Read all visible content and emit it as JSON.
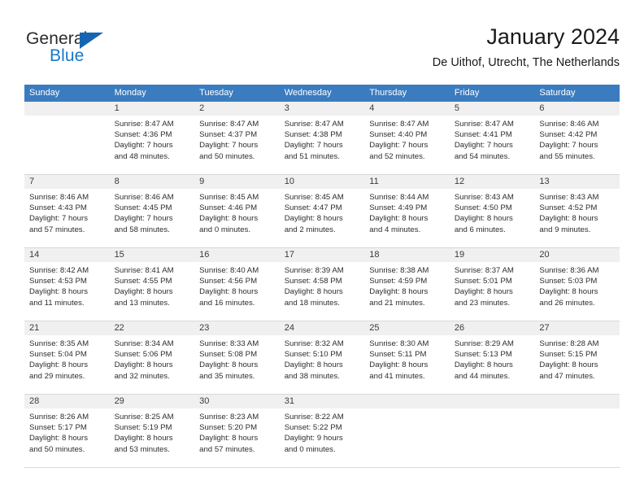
{
  "brand": {
    "name_top": "General",
    "name_bottom": "Blue",
    "accent_color": "#1878c8",
    "triangle_color": "#1565b0"
  },
  "header": {
    "title": "January 2024",
    "subtitle": "De Uithof, Utrecht, The Netherlands"
  },
  "calendar": {
    "header_bg": "#3b7cc0",
    "daynum_bg": "#f0f0f0",
    "weekdays": [
      "Sunday",
      "Monday",
      "Tuesday",
      "Wednesday",
      "Thursday",
      "Friday",
      "Saturday"
    ],
    "weeks": [
      [
        {
          "day": "",
          "sunrise": "",
          "sunset": "",
          "daylight1": "",
          "daylight2": "",
          "empty": true
        },
        {
          "day": "1",
          "sunrise": "Sunrise: 8:47 AM",
          "sunset": "Sunset: 4:36 PM",
          "daylight1": "Daylight: 7 hours",
          "daylight2": "and 48 minutes."
        },
        {
          "day": "2",
          "sunrise": "Sunrise: 8:47 AM",
          "sunset": "Sunset: 4:37 PM",
          "daylight1": "Daylight: 7 hours",
          "daylight2": "and 50 minutes."
        },
        {
          "day": "3",
          "sunrise": "Sunrise: 8:47 AM",
          "sunset": "Sunset: 4:38 PM",
          "daylight1": "Daylight: 7 hours",
          "daylight2": "and 51 minutes."
        },
        {
          "day": "4",
          "sunrise": "Sunrise: 8:47 AM",
          "sunset": "Sunset: 4:40 PM",
          "daylight1": "Daylight: 7 hours",
          "daylight2": "and 52 minutes."
        },
        {
          "day": "5",
          "sunrise": "Sunrise: 8:47 AM",
          "sunset": "Sunset: 4:41 PM",
          "daylight1": "Daylight: 7 hours",
          "daylight2": "and 54 minutes."
        },
        {
          "day": "6",
          "sunrise": "Sunrise: 8:46 AM",
          "sunset": "Sunset: 4:42 PM",
          "daylight1": "Daylight: 7 hours",
          "daylight2": "and 55 minutes."
        }
      ],
      [
        {
          "day": "7",
          "sunrise": "Sunrise: 8:46 AM",
          "sunset": "Sunset: 4:43 PM",
          "daylight1": "Daylight: 7 hours",
          "daylight2": "and 57 minutes."
        },
        {
          "day": "8",
          "sunrise": "Sunrise: 8:46 AM",
          "sunset": "Sunset: 4:45 PM",
          "daylight1": "Daylight: 7 hours",
          "daylight2": "and 58 minutes."
        },
        {
          "day": "9",
          "sunrise": "Sunrise: 8:45 AM",
          "sunset": "Sunset: 4:46 PM",
          "daylight1": "Daylight: 8 hours",
          "daylight2": "and 0 minutes."
        },
        {
          "day": "10",
          "sunrise": "Sunrise: 8:45 AM",
          "sunset": "Sunset: 4:47 PM",
          "daylight1": "Daylight: 8 hours",
          "daylight2": "and 2 minutes."
        },
        {
          "day": "11",
          "sunrise": "Sunrise: 8:44 AM",
          "sunset": "Sunset: 4:49 PM",
          "daylight1": "Daylight: 8 hours",
          "daylight2": "and 4 minutes."
        },
        {
          "day": "12",
          "sunrise": "Sunrise: 8:43 AM",
          "sunset": "Sunset: 4:50 PM",
          "daylight1": "Daylight: 8 hours",
          "daylight2": "and 6 minutes."
        },
        {
          "day": "13",
          "sunrise": "Sunrise: 8:43 AM",
          "sunset": "Sunset: 4:52 PM",
          "daylight1": "Daylight: 8 hours",
          "daylight2": "and 9 minutes."
        }
      ],
      [
        {
          "day": "14",
          "sunrise": "Sunrise: 8:42 AM",
          "sunset": "Sunset: 4:53 PM",
          "daylight1": "Daylight: 8 hours",
          "daylight2": "and 11 minutes."
        },
        {
          "day": "15",
          "sunrise": "Sunrise: 8:41 AM",
          "sunset": "Sunset: 4:55 PM",
          "daylight1": "Daylight: 8 hours",
          "daylight2": "and 13 minutes."
        },
        {
          "day": "16",
          "sunrise": "Sunrise: 8:40 AM",
          "sunset": "Sunset: 4:56 PM",
          "daylight1": "Daylight: 8 hours",
          "daylight2": "and 16 minutes."
        },
        {
          "day": "17",
          "sunrise": "Sunrise: 8:39 AM",
          "sunset": "Sunset: 4:58 PM",
          "daylight1": "Daylight: 8 hours",
          "daylight2": "and 18 minutes."
        },
        {
          "day": "18",
          "sunrise": "Sunrise: 8:38 AM",
          "sunset": "Sunset: 4:59 PM",
          "daylight1": "Daylight: 8 hours",
          "daylight2": "and 21 minutes."
        },
        {
          "day": "19",
          "sunrise": "Sunrise: 8:37 AM",
          "sunset": "Sunset: 5:01 PM",
          "daylight1": "Daylight: 8 hours",
          "daylight2": "and 23 minutes."
        },
        {
          "day": "20",
          "sunrise": "Sunrise: 8:36 AM",
          "sunset": "Sunset: 5:03 PM",
          "daylight1": "Daylight: 8 hours",
          "daylight2": "and 26 minutes."
        }
      ],
      [
        {
          "day": "21",
          "sunrise": "Sunrise: 8:35 AM",
          "sunset": "Sunset: 5:04 PM",
          "daylight1": "Daylight: 8 hours",
          "daylight2": "and 29 minutes."
        },
        {
          "day": "22",
          "sunrise": "Sunrise: 8:34 AM",
          "sunset": "Sunset: 5:06 PM",
          "daylight1": "Daylight: 8 hours",
          "daylight2": "and 32 minutes."
        },
        {
          "day": "23",
          "sunrise": "Sunrise: 8:33 AM",
          "sunset": "Sunset: 5:08 PM",
          "daylight1": "Daylight: 8 hours",
          "daylight2": "and 35 minutes."
        },
        {
          "day": "24",
          "sunrise": "Sunrise: 8:32 AM",
          "sunset": "Sunset: 5:10 PM",
          "daylight1": "Daylight: 8 hours",
          "daylight2": "and 38 minutes."
        },
        {
          "day": "25",
          "sunrise": "Sunrise: 8:30 AM",
          "sunset": "Sunset: 5:11 PM",
          "daylight1": "Daylight: 8 hours",
          "daylight2": "and 41 minutes."
        },
        {
          "day": "26",
          "sunrise": "Sunrise: 8:29 AM",
          "sunset": "Sunset: 5:13 PM",
          "daylight1": "Daylight: 8 hours",
          "daylight2": "and 44 minutes."
        },
        {
          "day": "27",
          "sunrise": "Sunrise: 8:28 AM",
          "sunset": "Sunset: 5:15 PM",
          "daylight1": "Daylight: 8 hours",
          "daylight2": "and 47 minutes."
        }
      ],
      [
        {
          "day": "28",
          "sunrise": "Sunrise: 8:26 AM",
          "sunset": "Sunset: 5:17 PM",
          "daylight1": "Daylight: 8 hours",
          "daylight2": "and 50 minutes."
        },
        {
          "day": "29",
          "sunrise": "Sunrise: 8:25 AM",
          "sunset": "Sunset: 5:19 PM",
          "daylight1": "Daylight: 8 hours",
          "daylight2": "and 53 minutes."
        },
        {
          "day": "30",
          "sunrise": "Sunrise: 8:23 AM",
          "sunset": "Sunset: 5:20 PM",
          "daylight1": "Daylight: 8 hours",
          "daylight2": "and 57 minutes."
        },
        {
          "day": "31",
          "sunrise": "Sunrise: 8:22 AM",
          "sunset": "Sunset: 5:22 PM",
          "daylight1": "Daylight: 9 hours",
          "daylight2": "and 0 minutes."
        },
        {
          "day": "",
          "sunrise": "",
          "sunset": "",
          "daylight1": "",
          "daylight2": "",
          "empty": true
        },
        {
          "day": "",
          "sunrise": "",
          "sunset": "",
          "daylight1": "",
          "daylight2": "",
          "empty": true
        },
        {
          "day": "",
          "sunrise": "",
          "sunset": "",
          "daylight1": "",
          "daylight2": "",
          "empty": true
        }
      ]
    ]
  }
}
